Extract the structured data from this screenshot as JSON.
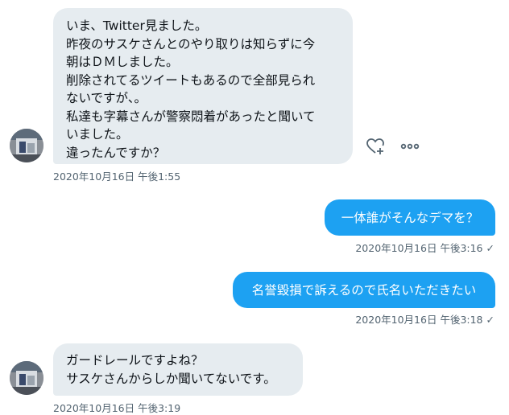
{
  "messages": [
    {
      "direction": "incoming",
      "lines": [
        "いま、Twitter見ました。",
        "昨夜のサスケさんとのやり取りは知らずに今",
        "朝はＤＭしました。",
        "削除されてるツイートもあるので全部見られ",
        "ないですが、。",
        "私達も字幕さんが警察悶着があったと聞いて",
        "いました。",
        "違ったんですか？"
      ],
      "timestamp": "2020年10月16日 午後1:55"
    },
    {
      "direction": "outgoing",
      "text": "一体誰がそんなデマを？",
      "timestamp": "2020年10月16日 午後3:16",
      "status_icon": "check-icon"
    },
    {
      "direction": "outgoing",
      "text": "名誉毀損で訴えるので氏名いただきたい",
      "timestamp": "2020年10月16日 午後3:18",
      "status_icon": "check-icon"
    },
    {
      "direction": "incoming",
      "lines": [
        "ガードレールですよね？",
        "サスケさんからしか聞いてないです。"
      ],
      "timestamp": "2020年10月16日 午後3:19"
    }
  ],
  "icons": {
    "react": "heart-plus-icon",
    "more": "more-horizontal-icon",
    "read": "check-icon"
  },
  "colors": {
    "incoming_bubble": "#e6ecf0",
    "outgoing_bubble": "#1da1f2",
    "timestamp": "#536471"
  },
  "status_glyph": "✓"
}
